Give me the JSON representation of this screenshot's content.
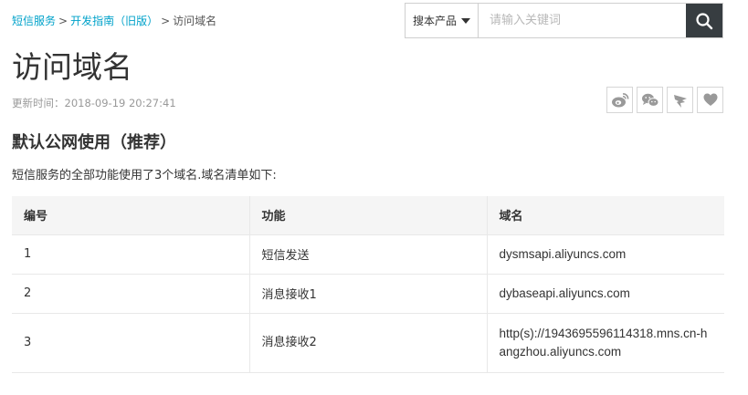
{
  "breadcrumb": {
    "items": [
      "短信服务",
      "开发指南（旧版）"
    ],
    "separator": ">",
    "current": "访问域名"
  },
  "search": {
    "scope_label": "搜本产品",
    "placeholder": "请输入关键词",
    "value": "",
    "button_icon": "search-icon"
  },
  "page": {
    "title": "访问域名",
    "update_time": "更新时间：2018-09-19 20:27:41"
  },
  "share": {
    "icons": [
      "weibo-icon",
      "wechat-icon",
      "dingtalk-icon",
      "favorite-heart-icon"
    ]
  },
  "section": {
    "title": "默认公网使用（推荐）",
    "intro": "短信服务的全部功能使用了3个域名.域名清单如下:"
  },
  "table": {
    "headers": [
      "编号",
      "功能",
      "域名"
    ],
    "rows": [
      [
        "1",
        "短信发送",
        "dysmsapi.aliyuncs.com"
      ],
      [
        "2",
        "消息接收1",
        "dybaseapi.aliyuncs.com"
      ],
      [
        "3",
        "消息接收2",
        "http(s)://1943695596114318.mns.cn-hangzhou.aliyuncs.com"
      ]
    ]
  },
  "colors": {
    "link": "#00a2ca",
    "search_button_bg": "#373d41",
    "table_header_bg": "#f5f5f5",
    "icon_gray": "#999999"
  }
}
